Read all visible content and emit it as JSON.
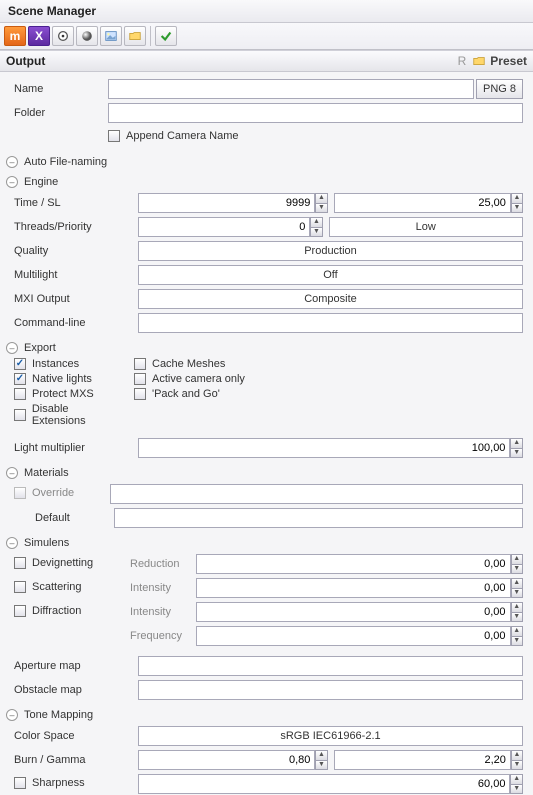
{
  "window": {
    "title": "Scene Manager"
  },
  "section": {
    "output": "Output",
    "preset": "Preset",
    "r": "R"
  },
  "name": {
    "label": "Name",
    "value": "",
    "ext": "PNG 8"
  },
  "folder": {
    "label": "Folder",
    "value": "",
    "append_label": "Append Camera Name"
  },
  "auto_file_naming": "Auto File-naming",
  "engine": {
    "title": "Engine",
    "time_sl": {
      "label": "Time / SL",
      "time": "9999",
      "sl": "25,00"
    },
    "threads_priority": {
      "label": "Threads/Priority",
      "threads": "0",
      "priority": "Low"
    },
    "quality": {
      "label": "Quality",
      "value": "Production"
    },
    "multilight": {
      "label": "Multilight",
      "value": "Off"
    },
    "mxi_output": {
      "label": "MXI Output",
      "value": "Composite"
    },
    "command_line": {
      "label": "Command-line",
      "value": ""
    }
  },
  "export": {
    "title": "Export",
    "instances": "Instances",
    "native_lights": "Native lights",
    "protect_mxs": "Protect MXS",
    "disable_ext": "Disable Extensions",
    "cache_meshes": "Cache Meshes",
    "active_camera_only": "Active camera only",
    "pack_and_go": "'Pack and Go'",
    "light_multiplier": {
      "label": "Light multiplier",
      "value": "100,00"
    }
  },
  "materials": {
    "title": "Materials",
    "override": "Override",
    "default": "Default",
    "override_value": "",
    "default_value": ""
  },
  "simulens": {
    "title": "Simulens",
    "devignetting": "Devignetting",
    "scattering": "Scattering",
    "diffraction": "Diffraction",
    "reduction": {
      "label": "Reduction",
      "value": "0,00"
    },
    "intensity1": {
      "label": "Intensity",
      "value": "0,00"
    },
    "intensity2": {
      "label": "Intensity",
      "value": "0,00"
    },
    "frequency": {
      "label": "Frequency",
      "value": "0,00"
    },
    "aperture_map": {
      "label": "Aperture map",
      "value": ""
    },
    "obstacle_map": {
      "label": "Obstacle map",
      "value": ""
    }
  },
  "tone": {
    "title": "Tone Mapping",
    "color_space": {
      "label": "Color Space",
      "value": "sRGB IEC61966-2.1"
    },
    "burn_gamma": {
      "label": "Burn / Gamma",
      "burn": "0,80",
      "gamma": "2,20"
    },
    "sharpness": {
      "label": "Sharpness",
      "value": "60,00"
    }
  }
}
